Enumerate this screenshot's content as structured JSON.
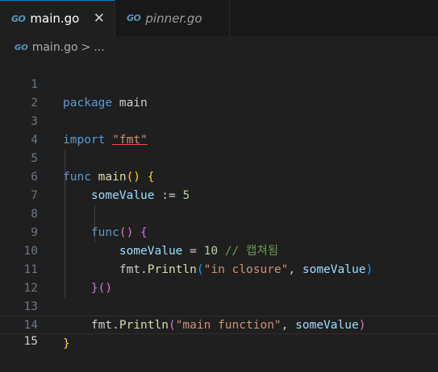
{
  "tabs": [
    {
      "label": "main.go",
      "icon": "go-file-icon",
      "active": true,
      "close": "✕"
    },
    {
      "label": "pinner.go",
      "icon": "go-file-icon",
      "active": false
    }
  ],
  "go_icon_text": "GO",
  "breadcrumb": {
    "file": "main.go",
    "separator": ">",
    "more": "..."
  },
  "colors": {
    "keyword": "#569cd6",
    "string": "#ce9178",
    "function": "#dcdcaa",
    "variable": "#9cdcfe",
    "number": "#b5cea8",
    "comment": "#6a9955",
    "bracket_level1": "#ffd700",
    "bracket_level2": "#da70d6",
    "bracket_level3": "#179fff"
  },
  "code": {
    "line_numbers": [
      "1",
      "2",
      "3",
      "4",
      "5",
      "6",
      "7",
      "8",
      "9",
      "10",
      "11",
      "12",
      "13",
      "14",
      "15"
    ],
    "current_line": "15",
    "l1": {
      "kw": "package",
      "name": "main"
    },
    "l3": {
      "kw": "import",
      "str": "\"fmt\""
    },
    "l5": {
      "kw": "func",
      "name": "main",
      "paren": "()",
      "brace": "{"
    },
    "l6": {
      "var": "someValue",
      "op": ":=",
      "num": "5"
    },
    "l8": {
      "kw": "func",
      "paren": "()",
      "brace": "{"
    },
    "l9": {
      "var": "someValue",
      "op": "=",
      "num": "10",
      "comment": "// 캡쳐됨"
    },
    "l10": {
      "pkg": "fmt",
      "dot": ".",
      "fn": "Println",
      "open": "(",
      "str": "\"in closure\"",
      "comma": ", ",
      "var": "someValue",
      "close": ")"
    },
    "l11": {
      "brace": "}",
      "paren": "()"
    },
    "l13": {
      "pkg": "fmt",
      "dot": ".",
      "fn": "Println",
      "open": "(",
      "str": "\"main function\"",
      "comma": ", ",
      "var": "someValue",
      "close": ")"
    },
    "l14": {
      "brace": "}"
    }
  }
}
